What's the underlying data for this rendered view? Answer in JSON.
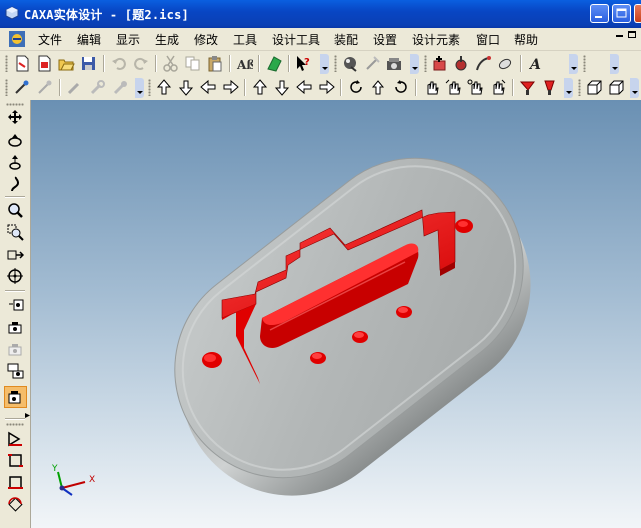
{
  "window": {
    "title": "CAXA实体设计 - [题2.ics]"
  },
  "menu": {
    "items": [
      "文件",
      "编辑",
      "显示",
      "生成",
      "修改",
      "工具",
      "设计工具",
      "装配",
      "设置",
      "设计元素",
      "窗口",
      "帮助"
    ]
  },
  "toolbar1": {
    "icons": [
      "new-icon",
      "new-template-icon",
      "open-icon",
      "save-icon",
      "undo-icon",
      "redo-icon",
      "cut-icon",
      "copy-icon",
      "paste-icon",
      "font-icon",
      "insert-part-icon",
      "help-pointer-icon",
      "smart-rendering-icon",
      "tool-wizard-icon",
      "render-icon",
      "standard-parts-icon",
      "generate-icon",
      "rotate-tool-icon",
      "curve-icon",
      "surface-icon",
      "text-icon"
    ]
  },
  "toolbar2": {
    "icons": [
      "pick-icon",
      "pen-icon",
      "measure-icon",
      "spanner-icon",
      "tag-icon",
      "arrow-up-icon",
      "arrow-down-icon",
      "arrow-left-icon",
      "arrow-right-icon",
      "move-up-icon",
      "move-down-icon",
      "move-left-icon",
      "move-right-icon",
      "rotate-ccw-icon",
      "arrow-up-small-icon",
      "rotate-cw-icon",
      "hand-icon",
      "hand2-icon",
      "hand3-icon",
      "hand4-icon",
      "light-icon",
      "light2-icon",
      "box-view-icon",
      "box-view2-icon"
    ]
  },
  "lefttoolbar": {
    "icons": [
      "pan-icon",
      "orbit-icon",
      "dynamic-rotate-icon",
      "walk-icon",
      "zoom-icon",
      "zoom-window-icon",
      "look-at-icon",
      "target-icon",
      "camera-icon",
      "camera2-icon",
      "camera3-icon",
      "camera4-icon",
      "visualization-icon",
      "draw-2d-icon",
      "rect-icon",
      "box-icon",
      "rotate-box-icon"
    ]
  },
  "axes": {
    "x": "X",
    "y": "Y"
  },
  "colors": {
    "feature_red": "#ff0000",
    "plate_gray": "#b4b8b8",
    "title_blue": "#0846c4"
  }
}
